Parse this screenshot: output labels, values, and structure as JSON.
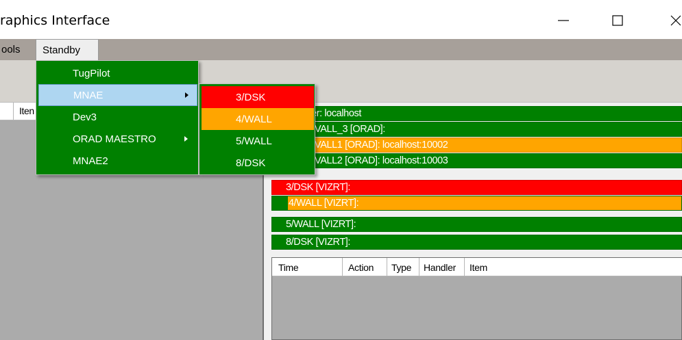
{
  "window": {
    "title": "raphics Interface"
  },
  "menubar": {
    "items": [
      {
        "label": "ools"
      },
      {
        "label": "Standby"
      }
    ]
  },
  "left_panel": {
    "columns": [
      "Iten"
    ]
  },
  "status_rows": [
    {
      "label": "er: localhost",
      "color": "#008000"
    },
    {
      "label": "VALL_3 [ORAD]:",
      "color": "#008000"
    },
    {
      "label": "VALL1 [ORAD]: localhost:10002",
      "color": "#ffa500"
    },
    {
      "label": "VALL2 [ORAD]: localhost:10003",
      "color": "#008000"
    },
    {
      "label": "3/DSK [VIZRT]:",
      "color": "#ff0000"
    },
    {
      "label": "4/WALL [VIZRT]:",
      "color": "#ffa500"
    },
    {
      "label": "5/WALL [VIZRT]:",
      "color": "#008000"
    },
    {
      "label": "8/DSK [VIZRT]:",
      "color": "#008000"
    }
  ],
  "log": {
    "columns": [
      "Time",
      "Action",
      "Type",
      "Handler",
      "Item"
    ]
  },
  "standby_menu": {
    "items": [
      {
        "label": "TugPilot",
        "has_submenu": false
      },
      {
        "label": "MNAE",
        "has_submenu": true,
        "highlighted": true
      },
      {
        "label": "Dev3",
        "has_submenu": false
      },
      {
        "label": "ORAD MAESTRO",
        "has_submenu": true
      },
      {
        "label": "MNAE2",
        "has_submenu": false
      }
    ]
  },
  "mnae_submenu": {
    "items": [
      {
        "label": "3/DSK",
        "color": "#ff0000"
      },
      {
        "label": "4/WALL",
        "color": "#ffa500"
      },
      {
        "label": "5/WALL",
        "color": "#008000"
      },
      {
        "label": "8/DSK",
        "color": "#008000"
      }
    ]
  },
  "colors": {
    "ok": "#008000",
    "warning": "#ffa500",
    "error": "#ff0000",
    "highlight": "#aed6f1"
  }
}
